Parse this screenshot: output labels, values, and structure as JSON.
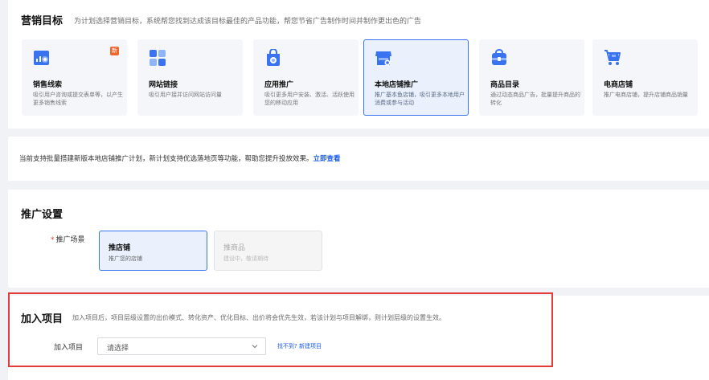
{
  "marketing_goal": {
    "title": "营销目标",
    "description": "为计划选择营销目标，系统帮您找到达成该目标最佳的产品功能，帮您节省广告制作时间并制作更出色的广告",
    "new_badge": "新",
    "tiles": [
      {
        "title": "销售线索",
        "desc": "吸引用户咨询或提交表单等，以产生更多销售线索",
        "icon": "leads-chart-icon"
      },
      {
        "title": "网站链接",
        "desc": "吸引用户接并访问网站访问量",
        "icon": "website-grid-icon"
      },
      {
        "title": "应用推广",
        "desc": "吸引更多用户安装、激活、活跃使用您的移动应用",
        "icon": "app-bag-icon"
      },
      {
        "title": "本地店铺推广",
        "desc": "推广基本鱼店铺，吸引更多本地用户消费或参与活动",
        "icon": "local-store-icon"
      },
      {
        "title": "商品目录",
        "desc": "通过动态商品广告，批量提升商品的转化",
        "icon": "catalog-bag-icon"
      },
      {
        "title": "电商店铺",
        "desc": "推广电商店铺，提升店铺商品销量",
        "icon": "shopping-cart-icon"
      }
    ]
  },
  "notice": {
    "text": "当前支持批量搭建新版本地店铺推广计划，新计划支持优选落地页等功能，帮助您提升投放效果。",
    "link": "立即查看"
  },
  "promo_settings": {
    "title": "推广设置",
    "required_mark": "*",
    "scene_label": "推广场景",
    "scenes": [
      {
        "title": "推店铺",
        "desc": "推广您的店铺"
      },
      {
        "title": "推商品",
        "desc": "建设中，敬请期待"
      }
    ]
  },
  "join_project": {
    "title": "加入项目",
    "description": "加入项目后，项目层级设置的出价模式、转化资产、优化目标、出价将会优先生效，若该计划与项目解绑，则计划层级的设置生效。",
    "field_label": "加入项目",
    "select_placeholder": "请选择",
    "link": "找不到? 新建项目"
  },
  "colors": {
    "accent": "#3a73f0",
    "highlight_outline": "#e33a3a"
  }
}
